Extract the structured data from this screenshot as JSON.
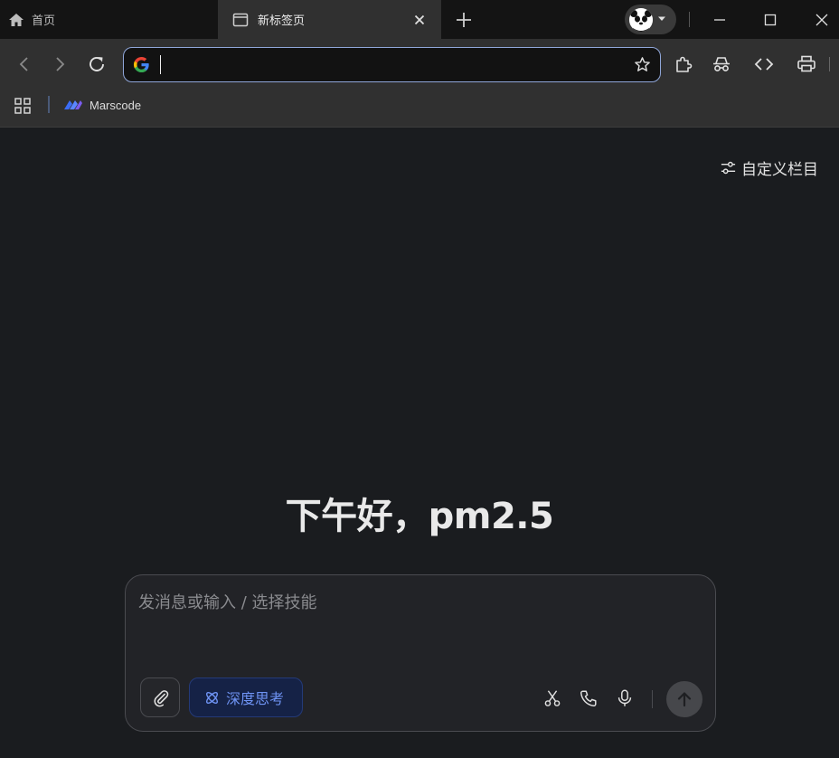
{
  "tabs": [
    {
      "label": "首页",
      "icon": "home-icon",
      "active": false
    },
    {
      "label": "新标签页",
      "icon": "page-icon",
      "active": true
    }
  ],
  "omnibox": {
    "value": "",
    "placeholder": ""
  },
  "bookmarks": [
    {
      "label": "Marscode",
      "icon": "marscode-logo"
    }
  ],
  "customize_label": "自定义栏目",
  "greeting": "下午好，pm2.5",
  "chat": {
    "placeholder": "发消息或输入 / 选择技能",
    "deep_think_label": "深度思考"
  },
  "colors": {
    "background": "#1a1c1f",
    "toolbar": "#303030",
    "accent_blue": "#6e93f3",
    "omnibox_border": "#8fa6d9"
  }
}
